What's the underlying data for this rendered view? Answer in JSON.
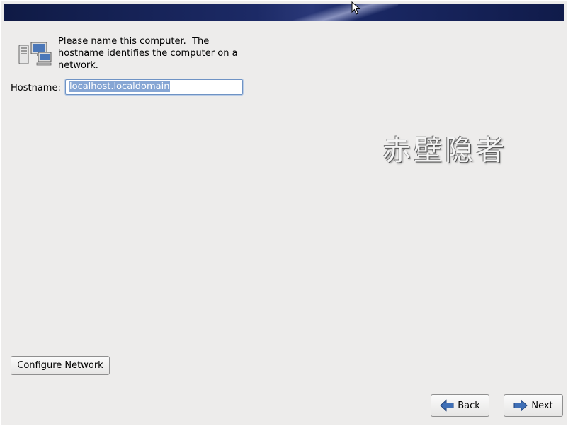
{
  "intro": {
    "line1": "Please name this computer.  The",
    "line2": "hostname identifies the computer on a",
    "line3": "network."
  },
  "hostname": {
    "label": "Hostname:",
    "value": "localhost.localdomain"
  },
  "watermark": "赤壁隐者",
  "buttons": {
    "configure_network": "Configure Network",
    "back": "Back",
    "next": "Next"
  },
  "icons": {
    "header": "network-computers-icon",
    "back": "arrow-left-icon",
    "next": "arrow-right-icon",
    "cursor": "mouse-pointer-icon"
  }
}
